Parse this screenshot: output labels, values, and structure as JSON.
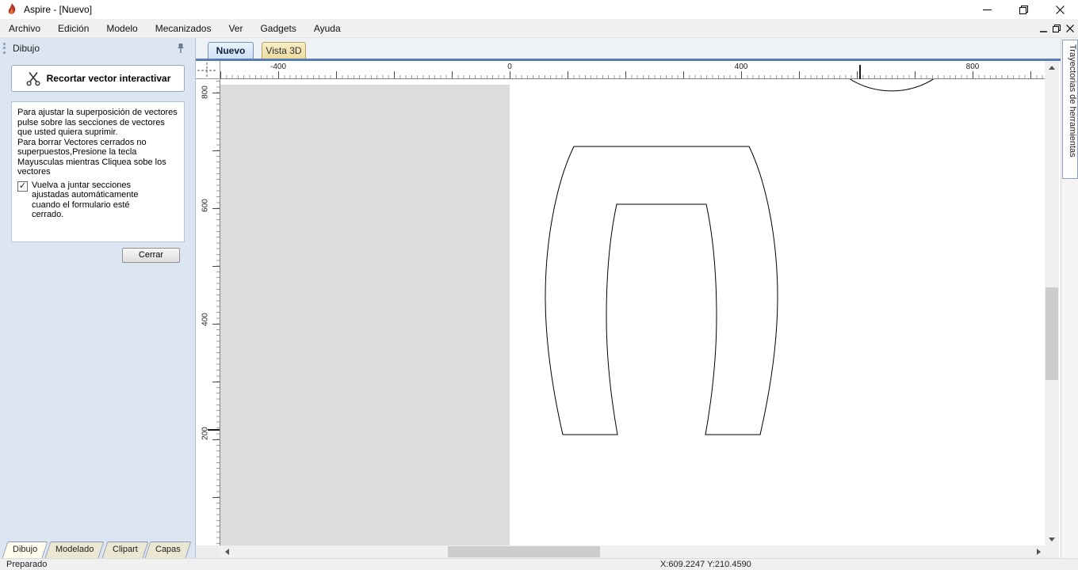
{
  "window": {
    "title": "Aspire - [Nuevo]"
  },
  "menu": {
    "items": [
      "Archivo",
      "Edición",
      "Modelo",
      "Mecanizados",
      "Ver",
      "Gadgets",
      "Ayuda"
    ]
  },
  "sidebar": {
    "title": "Dibujo",
    "tool_button": "Recortar vector interactivar",
    "instructions": [
      "Para ajustar la superposición de vectores pulse sobre las secciones de vectores que usted quiera suprimir.",
      "Para borrar Vectores cerrados no superpuestos,Presione la tecla Mayusculas mientras Cliquea sobe los vectores"
    ],
    "checkbox_label": "Vuelva a juntar secciones ajustadas automáticamente cuando el formulario esté cerrado.",
    "checkbox_checked": true,
    "checkbox_glyph": "✓",
    "close_button": "Cerrar",
    "tabs": [
      {
        "label": "Dibujo",
        "active": true
      },
      {
        "label": "Modelado",
        "active": false
      },
      {
        "label": "Clipart",
        "active": false
      },
      {
        "label": "Capas",
        "active": false
      }
    ]
  },
  "document": {
    "tabs": [
      {
        "label": "Nuevo",
        "active": true
      },
      {
        "label": "Vista 3D",
        "active": false
      }
    ],
    "ruler_h": [
      "-400",
      "0",
      "400",
      "800"
    ],
    "ruler_v": [
      "800",
      "600",
      "400",
      "200"
    ]
  },
  "canvas": {
    "shapes": [
      "arch-vector-outline",
      "partial-circle-arc"
    ],
    "outside_job_color": "#dcdcdc"
  },
  "right_panel": {
    "label": "Trayectorias de herramientas"
  },
  "statusbar": {
    "status": "Preparado",
    "coordinates": "X:609.2247 Y:210.4590"
  },
  "colors": {
    "accent_line": "#5a7db0",
    "sidebar_bg": "#dce6f3",
    "active_tab_bg": "#d9e7f9",
    "vista_tab_bg": "#f2e4ae",
    "vector_stroke": "#000000"
  }
}
